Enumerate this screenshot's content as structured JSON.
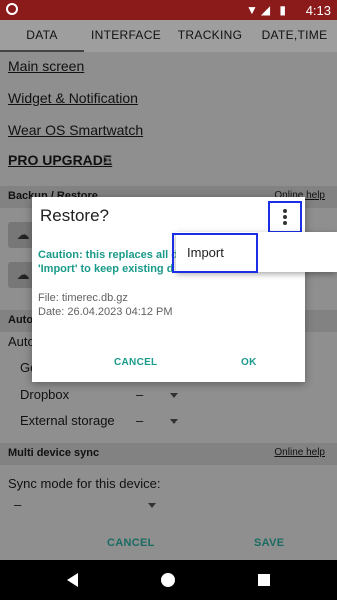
{
  "status_bar": {
    "time": "4:13",
    "icons": "▼◢ ▮"
  },
  "tabs": [
    {
      "label": "DATA"
    },
    {
      "label": "INTERFACE"
    },
    {
      "label": "TRACKING"
    },
    {
      "label": "DATE,TIME"
    }
  ],
  "main": {
    "links": [
      {
        "label": "Main screen"
      },
      {
        "label": "Widget & Notification"
      },
      {
        "label": "Wear OS Smartwatch"
      },
      {
        "label": "PRO UPGRADE"
      }
    ],
    "pro_close": "✕",
    "backup_section": {
      "title": "Backup / Restore",
      "help": "Online help"
    },
    "auto_section": {
      "title": "Auto"
    },
    "auto_row": "Auto",
    "storage_rows": [
      {
        "label": "Go",
        "value": "–"
      },
      {
        "label": "Dropbox",
        "value": "–"
      },
      {
        "label": "External storage",
        "value": "–"
      }
    ],
    "multi_device": {
      "title": "Multi device sync",
      "help": "Online help"
    },
    "sync_mode_label": "Sync mode for this device:",
    "sync_mode_value": "–",
    "cancel": "CANCEL",
    "save": "SAVE"
  },
  "dialog": {
    "title": "Restore?",
    "warning_line1": "Caution: this replaces all d",
    "warning_line2": "'Import' to keep existing d",
    "file_line": "File: timerec.db.gz",
    "date_line": "Date: 26.04.2023 04:12 PM",
    "cancel": "CANCEL",
    "ok": "OK"
  },
  "popup_menu": {
    "items": [
      {
        "label": "Import"
      }
    ]
  },
  "colors": {
    "accent": "#1a9a8a",
    "status_bar": "#8b1a1a",
    "highlight_box": "#1a2ee6"
  }
}
